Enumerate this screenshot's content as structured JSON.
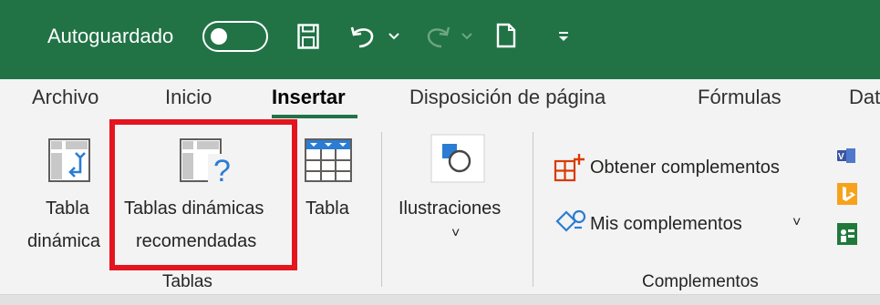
{
  "titlebar": {
    "autosave_label": "Autoguardado",
    "autosave_state": "off",
    "icons": [
      "save-icon",
      "undo-icon",
      "undo-dropdown-icon",
      "redo-icon",
      "redo-dropdown-icon",
      "new-file-icon",
      "customize-qat-icon"
    ]
  },
  "menu": {
    "tabs": [
      "Archivo",
      "Inicio",
      "Insertar",
      "Disposición de página",
      "Fórmulas",
      "Dat"
    ],
    "active_tab": "Insertar"
  },
  "ribbon": {
    "tablas": {
      "group_label": "Tablas",
      "pivot_table": {
        "line1": "Tabla",
        "line2": "dinámica"
      },
      "recommended_pivot": {
        "line1": "Tablas dinámicas",
        "line2": "recomendadas"
      },
      "table": {
        "line1": "Tabla"
      }
    },
    "ilustraciones": {
      "label": "Ilustraciones",
      "dropdown": "˅"
    },
    "complementos": {
      "group_label": "Complementos",
      "get_addins": "Obtener complementos",
      "my_addins": "Mis complementos",
      "my_addins_dropdown": "˅"
    },
    "right_icons": [
      "visio-icon",
      "bing-maps-icon",
      "people-graph-icon"
    ]
  },
  "colors": {
    "accent": "#217346",
    "highlight": "#e4151f",
    "addin_orange": "#d83b01",
    "link_blue": "#2b7cd3"
  }
}
